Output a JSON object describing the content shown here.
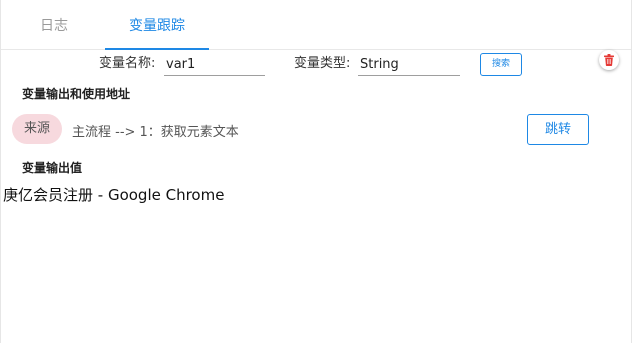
{
  "tabs": [
    {
      "label": "日志",
      "active": false
    },
    {
      "label": "变量跟踪",
      "active": true
    }
  ],
  "search": {
    "name_label": "变量名称:",
    "name_value": "var1",
    "type_label": "变量类型:",
    "type_value": "String",
    "search_button": "搜索"
  },
  "delete_icon": "trash-icon",
  "sections": {
    "usage_title": "变量输出和使用地址",
    "output_title": "变量输出值"
  },
  "source": {
    "badge": "来源",
    "path": "主流程 --> 1：获取元素文本",
    "jump_button": "跳转"
  },
  "output_value": "庚亿会员注册 - Google Chrome",
  "colors": {
    "accent": "#1e88e5",
    "badge_bg": "#f7d9de",
    "delete_icon": "#e53935"
  }
}
